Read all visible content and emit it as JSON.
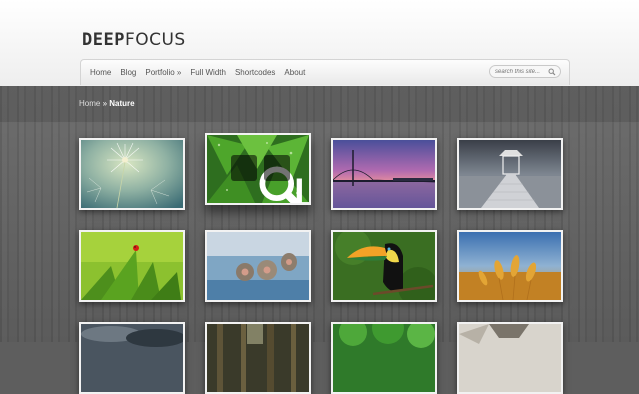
{
  "logo": {
    "part1": "DEEP",
    "part2": "FOCUS"
  },
  "nav": {
    "items": [
      {
        "label": "Home"
      },
      {
        "label": "Blog"
      },
      {
        "label": "Portfolio »"
      },
      {
        "label": "Full Width"
      },
      {
        "label": "Shortcodes"
      },
      {
        "label": "About"
      }
    ]
  },
  "search": {
    "placeholder": "search this site..."
  },
  "breadcrumb": {
    "home": "Home",
    "separator": "»",
    "current": "Nature"
  },
  "gallery": {
    "items": [
      {
        "subject": "dandelion"
      },
      {
        "subject": "green leaves with water drops"
      },
      {
        "subject": "bridge at sunset"
      },
      {
        "subject": "pier gazebo"
      },
      {
        "subject": "ladybug on grass"
      },
      {
        "subject": "snow monkeys in hot spring"
      },
      {
        "subject": "toucan"
      },
      {
        "subject": "wheat field"
      },
      {
        "subject": "cloudy sky"
      },
      {
        "subject": "forest"
      },
      {
        "subject": "green forest"
      },
      {
        "subject": "wolf"
      }
    ]
  },
  "hover_overlay": {
    "zoom_icon": "magnifier-icon",
    "link_icon": "external-link-icon"
  },
  "colors": {
    "background": "#5e5e5e",
    "header": "#ffffff",
    "thumb_border": "#f2f2f2"
  }
}
